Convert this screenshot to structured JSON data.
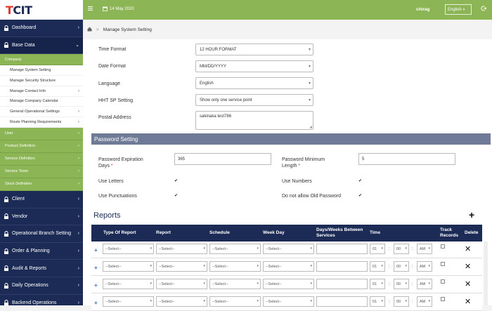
{
  "brand": {
    "logo_text": "CIT"
  },
  "topbar": {
    "date": "14 May 2020",
    "user": "chirag",
    "language": "English"
  },
  "sidebar": {
    "items_top": [
      {
        "label": "Dashboard"
      },
      {
        "label": "Base Data"
      }
    ],
    "company": {
      "label": "Company"
    },
    "company_sub": [
      {
        "label": "Manage System Setting"
      },
      {
        "label": "Manage Security Structure"
      },
      {
        "label": "Manage Contact Info"
      },
      {
        "label": "Manage Company Calendar"
      },
      {
        "label": "General Operational Settings"
      },
      {
        "label": "Route Planning Requirements"
      }
    ],
    "green_items": [
      {
        "label": "User"
      },
      {
        "label": "Product Definition"
      },
      {
        "label": "Service Definition"
      },
      {
        "label": "Service Team"
      },
      {
        "label": "Stock Definition"
      }
    ],
    "items_bottom": [
      {
        "label": "Client"
      },
      {
        "label": "Vendor"
      },
      {
        "label": "Operational Branch Setting"
      },
      {
        "label": "Order & Planning"
      },
      {
        "label": "Audit & Reports"
      },
      {
        "label": "Daily Operations"
      },
      {
        "label": "Backend Operations"
      }
    ]
  },
  "breadcrumb": {
    "current": "Manage System Setting"
  },
  "form": {
    "time_format_label": "Time Format",
    "time_format_value": "12 HOUR FORMAT",
    "date_format_label": "Date Format",
    "date_format_value": "MM/DD/YYYY",
    "language_label": "Language",
    "language_value": "English",
    "hht_label": "HHT SP Setting",
    "hht_value": "Show only one service point",
    "postal_label": "Postal Address",
    "postal_value": "sakinaka test786"
  },
  "password": {
    "section_title": "Password Setting",
    "expiration_label_1": "Password Expiration",
    "expiration_label_2": "Days",
    "expiration_value": "365",
    "minlen_label_1": "Password Minimum",
    "minlen_label_2": "Length",
    "minlen_value": "5",
    "use_letters_label": "Use Letters",
    "use_numbers_label": "Use Numbers",
    "use_punct_label": "Use Punctuations",
    "no_old_label": "Do not allow Old Password",
    "required_mark": "*",
    "check_mark": "✔"
  },
  "reports": {
    "title": "Reports",
    "add_symbol": "+",
    "headers": {
      "type": "Type Of Report",
      "report": "Report",
      "schedule": "Schedule",
      "weekday": "Week Day",
      "days1": "Days/Weeks Between",
      "days2": "Services",
      "time": "Time",
      "track1": "Track",
      "track2": "Records",
      "delete": "Delete"
    },
    "row_select_placeholder": "--Select--",
    "hour": "01",
    "minute": "00",
    "ampm": "AM",
    "time_sep": ":",
    "row_add_symbol": "+",
    "delete_symbol": "✕"
  }
}
